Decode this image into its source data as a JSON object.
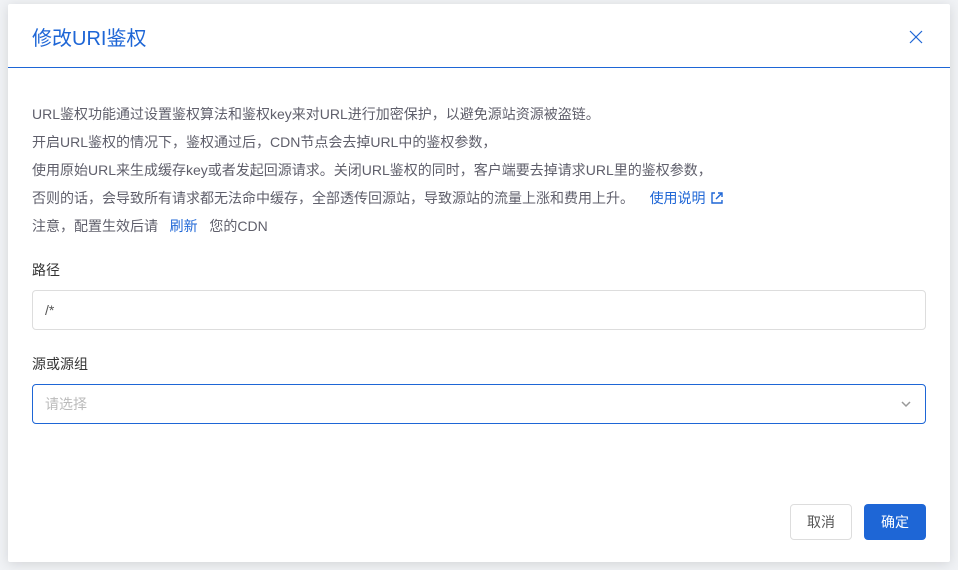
{
  "modal": {
    "title": "修改URI鉴权",
    "description": {
      "line1": "URL鉴权功能通过设置鉴权算法和鉴权key来对URL进行加密保护，以避免源站资源被盗链。",
      "line2": "开启URL鉴权的情况下，鉴权通过后，CDN节点会去掉URL中的鉴权参数，",
      "line3": "使用原始URL来生成缓存key或者发起回源请求。关闭URL鉴权的同时，客户端要去掉请求URL里的鉴权参数，",
      "line4_prefix": "否则的话，会导致所有请求都无法命中缓存，全部透传回源站，导致源站的流量上涨和费用上升。",
      "usage_link": "使用说明",
      "line5_prefix": "注意，配置生效后请",
      "refresh_link": "刷新",
      "line5_suffix": "您的CDN"
    },
    "form": {
      "path_label": "路径",
      "path_value": "/*",
      "origin_label": "源或源组",
      "origin_placeholder": "请选择"
    },
    "footer": {
      "cancel": "取消",
      "confirm": "确定"
    }
  }
}
